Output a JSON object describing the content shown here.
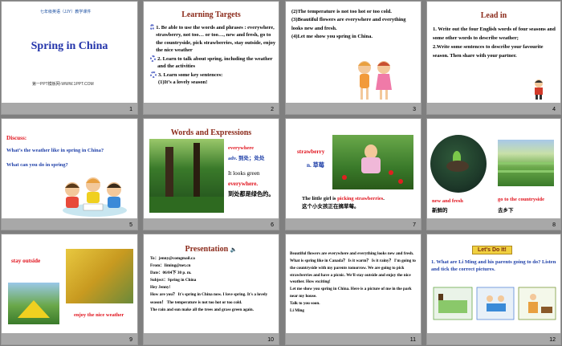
{
  "slides": [
    {
      "num": "1",
      "header_cn": "七年级英语（JJY）教学课件",
      "title": "Spring in China",
      "footer": "第一PPT模板网-WWW.1PPT.COM"
    },
    {
      "num": "2",
      "title": "Learning Targets",
      "item1": "1. Be able to use the words and phrases : everywhere, strawberry, not too… or too…, new and fresh, go to the countryside, pick strawberries, stay outside, enjoy the nice weather",
      "item2": "2. Learn to talk about spring, including the weather and the activities",
      "item3": "3. Learn some key sentences:",
      "item3a": "(1)It’s a lovely season!"
    },
    {
      "num": "3",
      "line2": "(2)The temperature is not too hot or too cold.",
      "line3": "(3)Beautiful flowers are everywhere and everything looks new and fresh.",
      "line4": "(4)Let me show you spring in China."
    },
    {
      "num": "4",
      "title": "Lead in",
      "p1": "1. Write out the four English words of four seasons and some other words to describe weather;",
      "p2": "2.Write some sentences to describe your favourite season. Then share with your partner."
    },
    {
      "num": "5",
      "label": "Discuss:",
      "q1": "What’s the weather like in spring in China?",
      "q2": "What can you do in spring?"
    },
    {
      "num": "6",
      "title": "Words and Expressions",
      "w1": "everywhere",
      "w1b": "adv. 到处；处处",
      "s1": "It looks green",
      "s1b": "everywhere.",
      "s1cn": "到处都是绿色的。"
    },
    {
      "num": "7",
      "word": "strawberry",
      "pos": "n. 草莓",
      "s_pre": "The little girl is ",
      "s_hl": "picking strawberries",
      "s_post": ".",
      "cn": "这个小女孩正在摘草莓。"
    },
    {
      "num": "8",
      "a": "new and fresh",
      "acn": "新鲜的",
      "b": "go to the countryside",
      "bcn": "去乡下"
    },
    {
      "num": "9",
      "a": "stay outside",
      "b": "enjoy the nice weather"
    },
    {
      "num": "10",
      "title": "Presentation",
      "lines": [
        "To：jenny@comgmail.ca",
        "From：Iiming@net.cn",
        "Date：06/04下 30 p.  m.",
        "Subject：Spring in China",
        "Hey Jenny!",
        "How are you？ It's spring in China now. I love spring. It's a lovely season！ The temperature is not too hot or too cold.",
        "The rain and sun make all the trees and grass green again."
      ]
    },
    {
      "num": "11",
      "text": "Beautiful flowers are everywhere and everything looks new and fresh. What is spring like in Canada？ Is it warm？ Is it rainy？ I'm going to the countryside with my parents tomorrow. We are going to pick strawberries and have a picnic. We'll stay outside and enjoy the nice weather. How exciting!",
      "text2": "Let me show you spring in China. Here is a picture of me in the park near my house.",
      "text3": "Talk to you soon.",
      "sig": "Li Ming"
    },
    {
      "num": "12",
      "badge": "Let's Do It!",
      "q": "1. What are Li Ming and his parents going to do? Listen and tick the correct pictures."
    }
  ],
  "colors": {
    "title_blue": "#2233aa",
    "red": "#e0101a",
    "bar": "#a8a8a8"
  }
}
